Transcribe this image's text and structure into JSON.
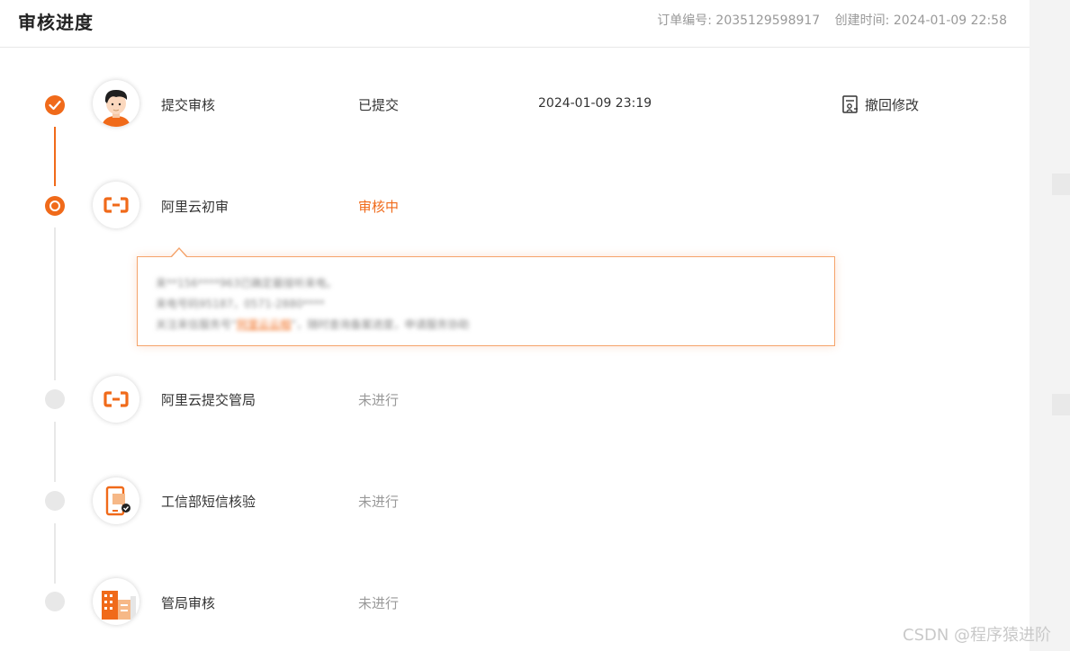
{
  "header": {
    "title": "审核进度",
    "order_no": "订单编号: 2035129598917",
    "created_time": "创建时间: 2024-01-09 22:58"
  },
  "steps": [
    {
      "name": "提交审核",
      "status": "已提交",
      "time": "2024-01-09 23:19",
      "state": "done",
      "icon": "user-avatar-icon"
    },
    {
      "name": "阿里云初审",
      "status": "审核中",
      "time": "",
      "state": "current",
      "icon": "aliyun-logo-icon"
    },
    {
      "name": "阿里云提交管局",
      "status": "未进行",
      "time": "",
      "state": "pending",
      "icon": "aliyun-logo-icon"
    },
    {
      "name": "工信部短信核验",
      "status": "未进行",
      "time": "",
      "state": "pending",
      "icon": "phone-verify-icon"
    },
    {
      "name": "管局审核",
      "status": "未进行",
      "time": "",
      "state": "pending",
      "icon": "building-icon"
    }
  ],
  "action": {
    "label": "撤回修改",
    "icon": "withdraw-edit-icon"
  },
  "tooltip": {
    "line1": "来**156****963已确定最接听来电。",
    "line2": "来电号码95187，0571-2880****",
    "line3_prefix": "关注来信服务号“",
    "line3_link": "阿里云云相",
    "line3_suffix": "”，随时查询备案进度，申请服务协助"
  },
  "colors": {
    "accent": "#f06a1a",
    "pending": "#e8e8e8",
    "muted": "#999999"
  },
  "watermark": "CSDN @程序猿进阶"
}
